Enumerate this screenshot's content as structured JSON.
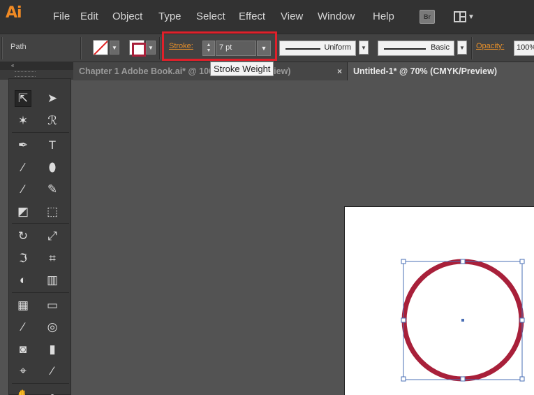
{
  "app": {
    "logo": "Ai"
  },
  "menu": [
    "File",
    "Edit",
    "Object",
    "Type",
    "Select",
    "Effect",
    "View",
    "Window",
    "Help"
  ],
  "bridge_button": "Br",
  "control_bar": {
    "selection_label": "Path",
    "stroke_label": "Stroke:",
    "stroke_value": "7 pt",
    "profile_uniform": "Uniform",
    "brush_basic": "Basic",
    "opacity_label": "Opacity:",
    "opacity_value": "100%"
  },
  "tooltip": "Stroke Weight",
  "tabs": [
    {
      "label": "Chapter 1 Adobe Book.ai* @ 100% (CMYK/Preview)",
      "active": false
    },
    {
      "label": "Untitled-1* @ 70% (CMYK/Preview)",
      "active": true
    }
  ],
  "tab_close_glyph": "×",
  "toolbox": {
    "collapse_glyph": "«",
    "tools": [
      {
        "name": "selection-tool-icon",
        "glyph": "⇱"
      },
      {
        "name": "direct-selection-tool-icon",
        "glyph": "➤"
      },
      {
        "name": "magic-wand-tool-icon",
        "glyph": "✶"
      },
      {
        "name": "lasso-tool-icon",
        "glyph": "ℛ"
      },
      {
        "name": "pen-tool-icon",
        "glyph": "✒"
      },
      {
        "name": "type-tool-icon",
        "glyph": "T"
      },
      {
        "name": "line-segment-tool-icon",
        "glyph": "∕"
      },
      {
        "name": "ellipse-tool-icon",
        "glyph": "⬮"
      },
      {
        "name": "paintbrush-tool-icon",
        "glyph": "⁄"
      },
      {
        "name": "pencil-tool-icon",
        "glyph": "✎"
      },
      {
        "name": "blob-brush-tool-icon",
        "glyph": "◩"
      },
      {
        "name": "eraser-tool-icon",
        "glyph": "⬚"
      },
      {
        "name": "rotate-tool-icon",
        "glyph": "↻"
      },
      {
        "name": "scale-tool-icon",
        "glyph": "⤢"
      },
      {
        "name": "width-tool-icon",
        "glyph": "ℑ"
      },
      {
        "name": "free-transform-tool-icon",
        "glyph": "⌗"
      },
      {
        "name": "shape-builder-tool-icon",
        "glyph": "◐"
      },
      {
        "name": "perspective-grid-tool-icon",
        "glyph": "▥"
      },
      {
        "name": "mesh-tool-icon",
        "glyph": "▦"
      },
      {
        "name": "gradient-tool-icon",
        "glyph": "▭"
      },
      {
        "name": "eyedropper-tool-icon",
        "glyph": "⁄"
      },
      {
        "name": "blend-tool-icon",
        "glyph": "◎"
      },
      {
        "name": "symbol-sprayer-tool-icon",
        "glyph": "◙"
      },
      {
        "name": "column-graph-tool-icon",
        "glyph": "▮"
      },
      {
        "name": "artboard-tool-icon",
        "glyph": "⌖"
      },
      {
        "name": "slice-tool-icon",
        "glyph": "⁄"
      },
      {
        "name": "hand-tool-icon",
        "glyph": "✋"
      },
      {
        "name": "zoom-tool-icon",
        "glyph": "⌕"
      }
    ]
  },
  "colors": {
    "accent": "#f08a24",
    "stroke_color": "#a8203a",
    "highlight": "#e0202a",
    "selection_blue": "#4a6fb5"
  }
}
